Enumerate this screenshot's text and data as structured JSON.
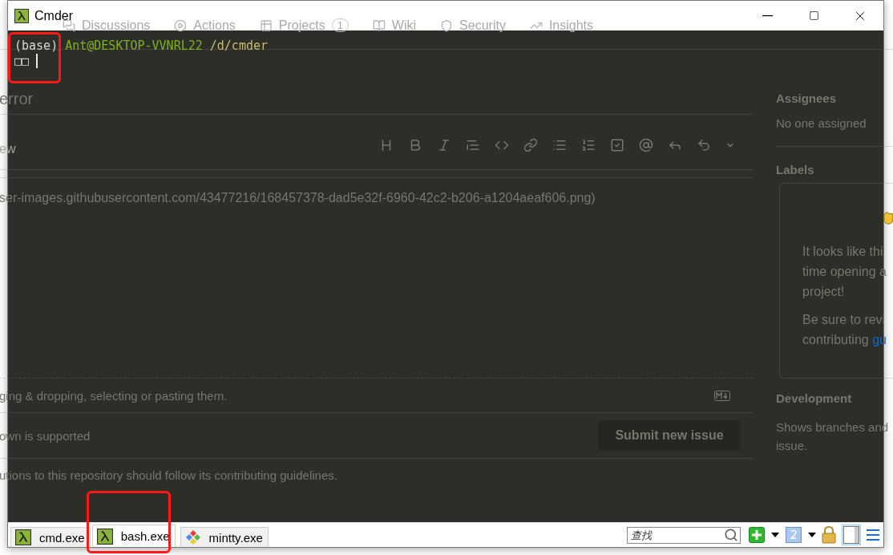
{
  "background_page": {
    "nav_tabs": [
      {
        "label": "Discussions"
      },
      {
        "label": "Actions"
      },
      {
        "label": "Projects",
        "count": "1"
      },
      {
        "label": "Wiki"
      },
      {
        "label": "Security"
      },
      {
        "label": "Insights"
      }
    ],
    "title_fragment": "error",
    "editor_tab_fragment": "ew",
    "body_text": "ser-images.githubusercontent.com/43477216/168457378-dad5e32f-6960-42c2-b206-a1204aeaf606.png)",
    "attach_hint": "ging & dropping, selecting or pasting them.",
    "markdown_note": "own is supported",
    "submit_button": "Submit new issue",
    "guidelines_note": "utions to this repository should follow its contributing guidelines.",
    "sidebar": {
      "assignees_heading": "Assignees",
      "assignees_value": "No one assigned",
      "labels_heading": "Labels",
      "welcome_lines": [
        "It looks like thi",
        "time opening a",
        "project!"
      ],
      "review_line": "Be sure to revi",
      "review_line2": "contributing ",
      "review_link": "gu",
      "development_heading": "Development",
      "development_lines": [
        "Shows branches and",
        "issue."
      ]
    }
  },
  "window": {
    "title": "Cmder"
  },
  "terminal": {
    "lines": [
      {
        "segments": [
          {
            "text": "(base)",
            "kind": "plain"
          },
          {
            "text": "Ant@DESKTOP-VVNRL22",
            "kind": "user"
          },
          {
            "text": "/d/cmder",
            "kind": "path"
          }
        ],
        "cursor": false
      },
      {
        "segments": [
          {
            "text": "□□",
            "kind": "plain"
          }
        ],
        "cursor": true
      }
    ]
  },
  "tabs": [
    {
      "label": "cmd.exe",
      "kind": "lambda",
      "selected": false
    },
    {
      "label": "bash.exe",
      "kind": "lambda",
      "selected": true
    },
    {
      "label": "mintty.exe",
      "kind": "git",
      "selected": false
    }
  ],
  "search": {
    "placeholder": "查找"
  },
  "split_view_pressed": true
}
